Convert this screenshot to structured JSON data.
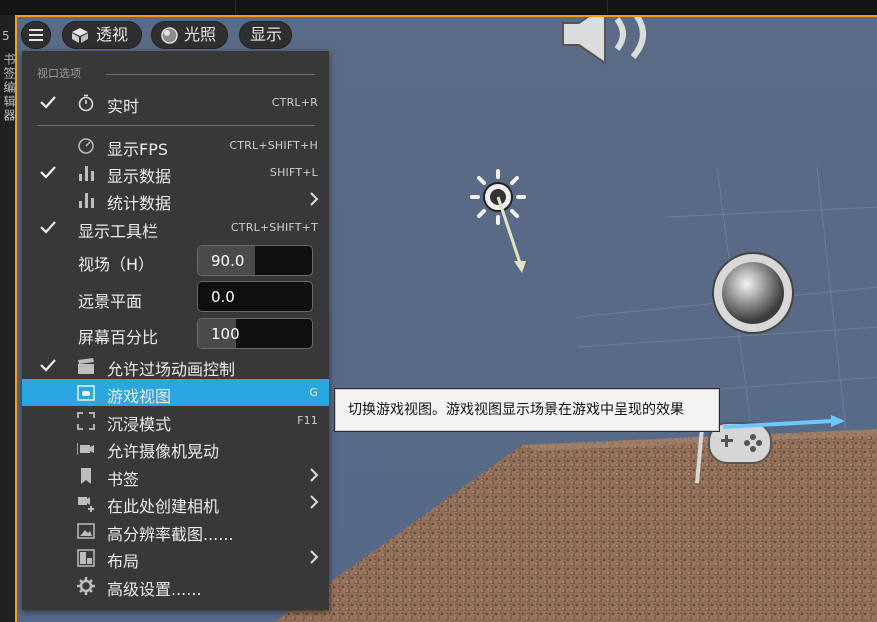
{
  "left_strip": {
    "top_char": "5",
    "vertical_text": "书签编辑器"
  },
  "toolbar": {
    "perspective_label": "透视",
    "lighting_label": "光照",
    "show_label": "显示"
  },
  "menu": {
    "section_header": "视口选项",
    "items": [
      {
        "label": "实时",
        "shortcut": "CTRL+R",
        "checked": true,
        "icon": "stopwatch-icon"
      },
      {
        "label": "显示FPS",
        "shortcut": "CTRL+SHIFT+H",
        "checked": false,
        "icon": "speedometer-icon"
      },
      {
        "label": "显示数据",
        "shortcut": "SHIFT+L",
        "checked": true,
        "icon": "bar-chart-icon"
      },
      {
        "label": "统计数据",
        "shortcut": "",
        "checked": false,
        "icon": "bar-chart-icon",
        "submenu": true
      },
      {
        "label": "显示工具栏",
        "shortcut": "CTRL+SHIFT+T",
        "checked": true,
        "icon": ""
      },
      {
        "label": "允许过场动画控制",
        "shortcut": "",
        "checked": true,
        "icon": "clapperboard-icon"
      },
      {
        "label": "游戏视图",
        "shortcut": "G",
        "checked": false,
        "icon": "game-view-icon",
        "selected": true
      },
      {
        "label": "沉浸模式",
        "shortcut": "F11",
        "checked": false,
        "icon": "fullscreen-icon"
      },
      {
        "label": "允许摄像机晃动",
        "shortcut": "",
        "checked": false,
        "icon": "camera-shake-icon"
      },
      {
        "label": "书签",
        "shortcut": "",
        "checked": false,
        "icon": "bookmark-icon",
        "submenu": true
      },
      {
        "label": "在此处创建相机",
        "shortcut": "",
        "checked": false,
        "icon": "create-camera-icon",
        "submenu": true
      },
      {
        "label": "高分辨率截图......",
        "shortcut": "",
        "checked": false,
        "icon": "screenshot-icon"
      },
      {
        "label": "布局",
        "shortcut": "",
        "checked": false,
        "icon": "layout-icon",
        "submenu": true
      },
      {
        "label": "高级设置......",
        "shortcut": "",
        "checked": false,
        "icon": "gear-icon"
      }
    ],
    "fields": [
      {
        "label": "视场（H）",
        "value": "90.0",
        "fill": 0.5
      },
      {
        "label": "远景平面",
        "value": "0.0",
        "fill": 0.0
      },
      {
        "label": "屏幕百分比",
        "value": "100",
        "fill": 0.33
      }
    ]
  },
  "tooltip": {
    "text": "切换游戏视图。游戏视图显示场景在游戏中呈现的效果"
  },
  "colors": {
    "selection": "#2aa6e0",
    "viewport_border": "#f0a21a",
    "menu_bg": "#383838"
  }
}
